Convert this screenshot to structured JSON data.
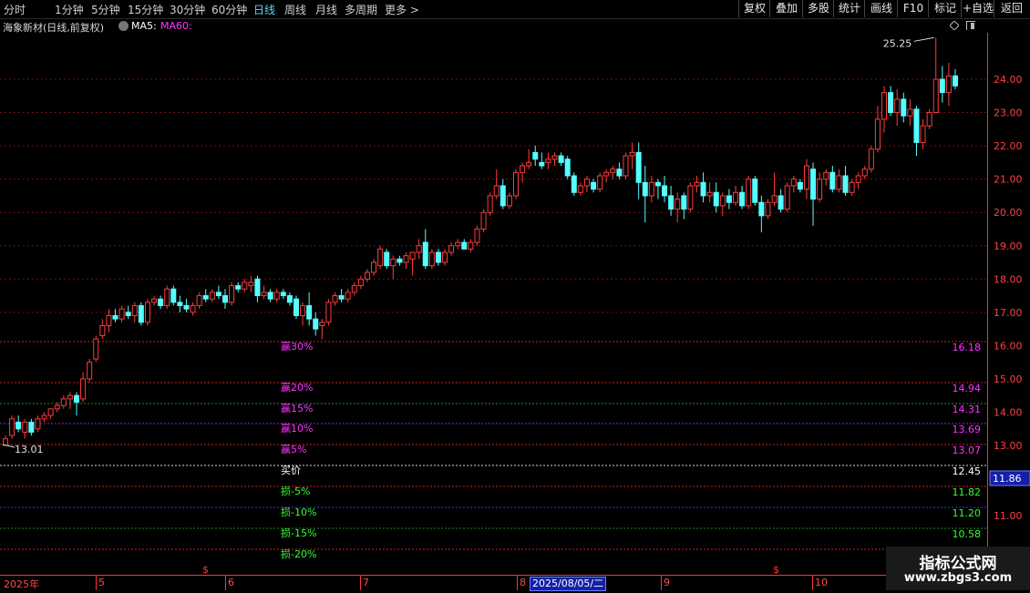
{
  "toolbar": {
    "periods": [
      {
        "label": "分时",
        "active": false
      },
      {
        "label": "1分钟",
        "active": false
      },
      {
        "label": "5分钟",
        "active": false
      },
      {
        "label": "15分钟",
        "active": false
      },
      {
        "label": "30分钟",
        "active": false
      },
      {
        "label": "60分钟",
        "active": false
      },
      {
        "label": "日线",
        "active": true
      },
      {
        "label": "周线",
        "active": false
      },
      {
        "label": "月线",
        "active": false
      },
      {
        "label": "多周期",
        "active": false
      },
      {
        "label": "更多 >",
        "active": false
      }
    ],
    "actions": [
      "复权",
      "叠加",
      "多股",
      "统计",
      "画线",
      "F10",
      "标记",
      "+自选",
      "返回"
    ]
  },
  "info": {
    "stock_label": "海象新材(日线,前复权)",
    "ma5_label": "MA5:",
    "ma60_label": "MA60:"
  },
  "colors": {
    "up": "#ff3b3b",
    "down": "#54ffff",
    "win_label": "#ff33ff",
    "loss_label": "#33ff33",
    "buy_label": "#ffffff"
  },
  "annotations": {
    "high_value": "25.25",
    "low_value": "13.01"
  },
  "levels": [
    {
      "label": "赢30%",
      "value": "16.18",
      "kind": "win"
    },
    {
      "label": "赢20%",
      "value": "14.94",
      "kind": "win"
    },
    {
      "label": "赢15%",
      "value": "14.31",
      "kind": "win"
    },
    {
      "label": "赢10%",
      "value": "13.69",
      "kind": "win"
    },
    {
      "label": "赢5%",
      "value": "13.07",
      "kind": "win"
    },
    {
      "label": "买价",
      "value": "12.45",
      "kind": "buy"
    },
    {
      "label": "损-5%",
      "value": "11.82",
      "kind": "loss"
    },
    {
      "label": "损-10%",
      "value": "11.20",
      "kind": "loss"
    },
    {
      "label": "损-15%",
      "value": "10.58",
      "kind": "loss"
    },
    {
      "label": "损-20%",
      "value": "",
      "kind": "loss"
    }
  ],
  "price_badge": "11.86",
  "bottom": {
    "months": [
      "2025年",
      "5",
      "6",
      "7",
      "8",
      "9",
      "10"
    ],
    "markers": [
      "$",
      "$"
    ],
    "selected_date": "2025/08/05/二"
  },
  "watermark": {
    "line1": "指标公式网",
    "line2": "www.zbgs3.com"
  },
  "chart_data": {
    "type": "candlestick",
    "y_ticks_upper": [
      24.0,
      23.0,
      22.0,
      21.0,
      20.0,
      19.0,
      18.0,
      17.0,
      16.0,
      15.0,
      14.0,
      13.0
    ],
    "y_ticks_lower": [
      11.0
    ],
    "ohlc": [
      [
        13.0,
        13.3,
        13.0,
        13.2
      ],
      [
        13.3,
        13.9,
        13.2,
        13.8
      ],
      [
        13.7,
        13.9,
        13.4,
        13.5
      ],
      [
        13.4,
        13.8,
        13.2,
        13.7
      ],
      [
        13.7,
        13.8,
        13.3,
        13.4
      ],
      [
        13.5,
        13.9,
        13.4,
        13.8
      ],
      [
        13.8,
        14.0,
        13.7,
        13.9
      ],
      [
        13.9,
        14.1,
        13.8,
        14.1
      ],
      [
        14.1,
        14.3,
        14.0,
        14.2
      ],
      [
        14.2,
        14.5,
        14.1,
        14.4
      ],
      [
        14.4,
        14.6,
        14.1,
        14.5
      ],
      [
        14.5,
        14.6,
        13.9,
        14.3
      ],
      [
        14.4,
        15.2,
        14.3,
        15.0
      ],
      [
        15.0,
        15.6,
        14.9,
        15.5
      ],
      [
        15.6,
        16.3,
        15.5,
        16.2
      ],
      [
        16.3,
        16.8,
        16.2,
        16.6
      ],
      [
        16.6,
        17.1,
        16.4,
        16.9
      ],
      [
        16.9,
        17.1,
        16.7,
        16.8
      ],
      [
        16.8,
        17.2,
        16.7,
        17.1
      ],
      [
        17.0,
        17.2,
        16.8,
        16.9
      ],
      [
        16.9,
        17.3,
        16.7,
        17.2
      ],
      [
        17.2,
        17.3,
        16.6,
        16.7
      ],
      [
        16.7,
        17.4,
        16.6,
        17.3
      ],
      [
        17.3,
        17.5,
        17.2,
        17.4
      ],
      [
        17.4,
        17.5,
        17.1,
        17.2
      ],
      [
        17.2,
        17.8,
        17.1,
        17.7
      ],
      [
        17.7,
        17.8,
        17.2,
        17.3
      ],
      [
        17.3,
        17.5,
        17.0,
        17.2
      ],
      [
        17.2,
        17.4,
        17.0,
        17.1
      ],
      [
        17.0,
        17.3,
        16.9,
        17.2
      ],
      [
        17.2,
        17.6,
        17.1,
        17.5
      ],
      [
        17.5,
        17.7,
        17.3,
        17.4
      ],
      [
        17.4,
        17.7,
        17.3,
        17.6
      ],
      [
        17.6,
        17.8,
        17.4,
        17.5
      ],
      [
        17.5,
        17.7,
        17.1,
        17.3
      ],
      [
        17.3,
        17.9,
        17.2,
        17.8
      ],
      [
        17.8,
        17.9,
        17.6,
        17.7
      ],
      [
        17.7,
        18.0,
        17.6,
        17.9
      ],
      [
        17.8,
        18.1,
        17.6,
        17.9
      ],
      [
        18.0,
        18.1,
        17.3,
        17.5
      ],
      [
        17.5,
        17.8,
        17.4,
        17.6
      ],
      [
        17.6,
        17.7,
        17.3,
        17.4
      ],
      [
        17.4,
        17.7,
        17.3,
        17.6
      ],
      [
        17.6,
        17.7,
        17.4,
        17.5
      ],
      [
        17.5,
        17.6,
        17.2,
        17.3
      ],
      [
        17.4,
        17.5,
        16.8,
        16.9
      ],
      [
        16.9,
        17.3,
        16.6,
        17.2
      ],
      [
        17.2,
        17.6,
        16.6,
        16.8
      ],
      [
        16.8,
        17.0,
        16.3,
        16.5
      ],
      [
        16.6,
        16.8,
        16.2,
        16.7
      ],
      [
        16.7,
        17.4,
        16.6,
        17.3
      ],
      [
        17.3,
        17.6,
        17.2,
        17.5
      ],
      [
        17.5,
        17.7,
        17.3,
        17.4
      ],
      [
        17.4,
        17.7,
        17.3,
        17.6
      ],
      [
        17.6,
        17.9,
        17.5,
        17.8
      ],
      [
        17.8,
        18.1,
        17.7,
        18.0
      ],
      [
        18.0,
        18.3,
        17.9,
        18.2
      ],
      [
        18.2,
        18.6,
        18.1,
        18.5
      ],
      [
        18.4,
        19.0,
        18.3,
        18.9
      ],
      [
        18.8,
        18.9,
        18.3,
        18.4
      ],
      [
        18.4,
        18.7,
        18.0,
        18.6
      ],
      [
        18.6,
        18.7,
        18.4,
        18.5
      ],
      [
        18.5,
        18.8,
        18.3,
        18.7
      ],
      [
        18.6,
        18.8,
        18.1,
        18.8
      ],
      [
        18.8,
        19.2,
        18.6,
        19.0
      ],
      [
        19.1,
        19.5,
        18.3,
        18.4
      ],
      [
        18.4,
        18.9,
        18.3,
        18.8
      ],
      [
        18.8,
        18.9,
        18.4,
        18.5
      ],
      [
        18.5,
        18.9,
        18.4,
        18.8
      ],
      [
        18.8,
        19.1,
        18.7,
        19.0
      ],
      [
        19.0,
        19.2,
        18.9,
        19.1
      ],
      [
        19.1,
        19.2,
        18.9,
        18.9
      ],
      [
        18.9,
        19.2,
        18.8,
        19.1
      ],
      [
        19.1,
        19.6,
        19.0,
        19.5
      ],
      [
        19.5,
        20.1,
        19.4,
        20.0
      ],
      [
        20.0,
        20.6,
        19.9,
        20.5
      ],
      [
        20.5,
        21.3,
        20.4,
        20.8
      ],
      [
        20.8,
        21.0,
        20.1,
        20.2
      ],
      [
        20.2,
        20.6,
        20.1,
        20.5
      ],
      [
        20.5,
        21.3,
        20.4,
        21.2
      ],
      [
        21.2,
        21.5,
        20.9,
        21.4
      ],
      [
        21.4,
        21.9,
        21.3,
        21.5
      ],
      [
        21.8,
        22.0,
        21.4,
        21.6
      ],
      [
        21.5,
        21.8,
        21.3,
        21.4
      ],
      [
        21.5,
        21.8,
        21.3,
        21.6
      ],
      [
        21.6,
        21.8,
        21.4,
        21.7
      ],
      [
        21.7,
        21.8,
        21.4,
        21.5
      ],
      [
        21.6,
        21.7,
        21.0,
        21.1
      ],
      [
        21.1,
        21.2,
        20.5,
        20.6
      ],
      [
        20.6,
        20.9,
        20.5,
        20.8
      ],
      [
        20.8,
        21.1,
        20.6,
        21.0
      ],
      [
        20.9,
        21.0,
        20.6,
        20.7
      ],
      [
        20.7,
        21.2,
        20.6,
        21.1
      ],
      [
        21.1,
        21.3,
        20.9,
        21.2
      ],
      [
        21.2,
        21.4,
        21.0,
        21.3
      ],
      [
        21.3,
        21.5,
        21.0,
        21.1
      ],
      [
        21.1,
        21.8,
        21.0,
        21.7
      ],
      [
        21.7,
        22.1,
        21.3,
        21.8
      ],
      [
        21.8,
        22.1,
        20.4,
        20.9
      ],
      [
        20.9,
        21.4,
        19.7,
        20.5
      ],
      [
        20.5,
        21.1,
        20.3,
        20.9
      ],
      [
        20.9,
        21.0,
        20.4,
        20.8
      ],
      [
        20.8,
        21.1,
        20.3,
        20.5
      ],
      [
        20.5,
        20.8,
        19.9,
        20.1
      ],
      [
        20.1,
        20.6,
        19.7,
        20.4
      ],
      [
        20.5,
        20.6,
        19.8,
        20.1
      ],
      [
        20.1,
        20.9,
        20.0,
        20.8
      ],
      [
        20.8,
        21.1,
        20.6,
        20.9
      ],
      [
        20.9,
        21.2,
        20.3,
        20.5
      ],
      [
        20.5,
        20.9,
        20.3,
        20.6
      ],
      [
        20.6,
        20.9,
        20.0,
        20.2
      ],
      [
        20.2,
        20.6,
        19.9,
        20.5
      ],
      [
        20.5,
        20.7,
        20.1,
        20.3
      ],
      [
        20.3,
        20.8,
        20.2,
        20.6
      ],
      [
        20.6,
        20.8,
        20.1,
        20.2
      ],
      [
        20.2,
        21.1,
        20.1,
        21.0
      ],
      [
        21.0,
        21.1,
        20.2,
        20.3
      ],
      [
        20.3,
        20.5,
        19.4,
        19.9
      ],
      [
        19.9,
        20.4,
        19.8,
        20.3
      ],
      [
        20.3,
        21.2,
        20.2,
        20.5
      ],
      [
        20.5,
        20.7,
        20.0,
        20.1
      ],
      [
        20.1,
        20.9,
        20.0,
        20.8
      ],
      [
        20.8,
        21.1,
        20.6,
        21.0
      ],
      [
        20.9,
        21.0,
        20.6,
        20.7
      ],
      [
        20.7,
        21.6,
        20.4,
        21.4
      ],
      [
        21.3,
        21.5,
        19.6,
        20.4
      ],
      [
        20.4,
        21.2,
        20.3,
        21.0
      ],
      [
        21.0,
        21.3,
        20.8,
        21.2
      ],
      [
        21.2,
        21.4,
        20.6,
        20.7
      ],
      [
        20.7,
        21.3,
        20.6,
        21.1
      ],
      [
        21.1,
        21.4,
        20.5,
        20.6
      ],
      [
        20.6,
        21.0,
        20.5,
        20.9
      ],
      [
        20.9,
        21.2,
        20.7,
        21.1
      ],
      [
        21.1,
        21.4,
        21.0,
        21.3
      ],
      [
        21.3,
        22.0,
        21.2,
        21.9
      ],
      [
        21.9,
        23.2,
        21.8,
        22.8
      ],
      [
        22.8,
        23.8,
        22.4,
        23.6
      ],
      [
        23.6,
        23.8,
        22.9,
        23.0
      ],
      [
        23.0,
        23.7,
        22.6,
        23.4
      ],
      [
        23.4,
        23.6,
        22.7,
        22.9
      ],
      [
        22.9,
        23.4,
        22.6,
        23.1
      ],
      [
        23.1,
        23.2,
        21.7,
        22.1
      ],
      [
        22.1,
        22.8,
        21.9,
        22.6
      ],
      [
        22.6,
        23.1,
        22.5,
        23.0
      ],
      [
        23.0,
        25.25,
        23.5,
        24.0
      ],
      [
        24.0,
        24.4,
        23.3,
        23.6
      ],
      [
        23.6,
        24.5,
        23.2,
        24.1
      ],
      [
        24.1,
        24.3,
        23.7,
        23.8
      ]
    ]
  }
}
